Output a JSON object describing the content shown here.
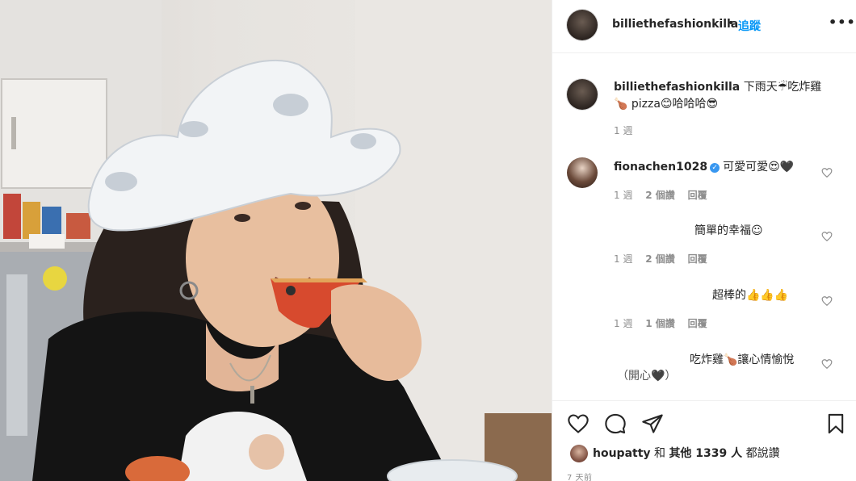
{
  "post": {
    "username": "billiethefashionkilla",
    "dot": "•",
    "follow_label": "追蹤",
    "more_label": "•••",
    "caption": {
      "username": "billiethefashionkilla",
      "text": "下雨天☔吃炸雞🍗 pizza😊哈哈哈😎",
      "time": "1 週"
    },
    "comments": [
      {
        "username": "fionachen1028",
        "verified": true,
        "text": "可愛可愛😍🖤",
        "time": "1 週",
        "likes": "2 個讚",
        "reply": "回覆"
      },
      {
        "username": "",
        "text": "簡單的幸福☺",
        "time": "1 週",
        "likes": "2 個讚",
        "reply": "回覆"
      },
      {
        "username": "",
        "text": "超棒的👍👍👍",
        "time": "1 週",
        "likes": "1 個讚",
        "reply": "回覆"
      },
      {
        "username": "",
        "text": "吃炸雞🍗讓心情愉悅",
        "text2": "（開心🖤）",
        "time": "",
        "likes": "",
        "reply": ""
      }
    ],
    "likes_summary": {
      "user": "houpatty",
      "and": "和",
      "others": "其他 1339 人",
      "suffix": "都說讚"
    },
    "time_ago": "7 天前"
  },
  "icons": [
    "heart-icon",
    "comment-icon",
    "share-icon",
    "bookmark-icon",
    "verified-icon",
    "more-icon"
  ],
  "colors": {
    "link": "#0095f6",
    "text": "#262626",
    "muted": "#8e8e8e",
    "border": "#efefef",
    "verified": "#3897f0"
  }
}
